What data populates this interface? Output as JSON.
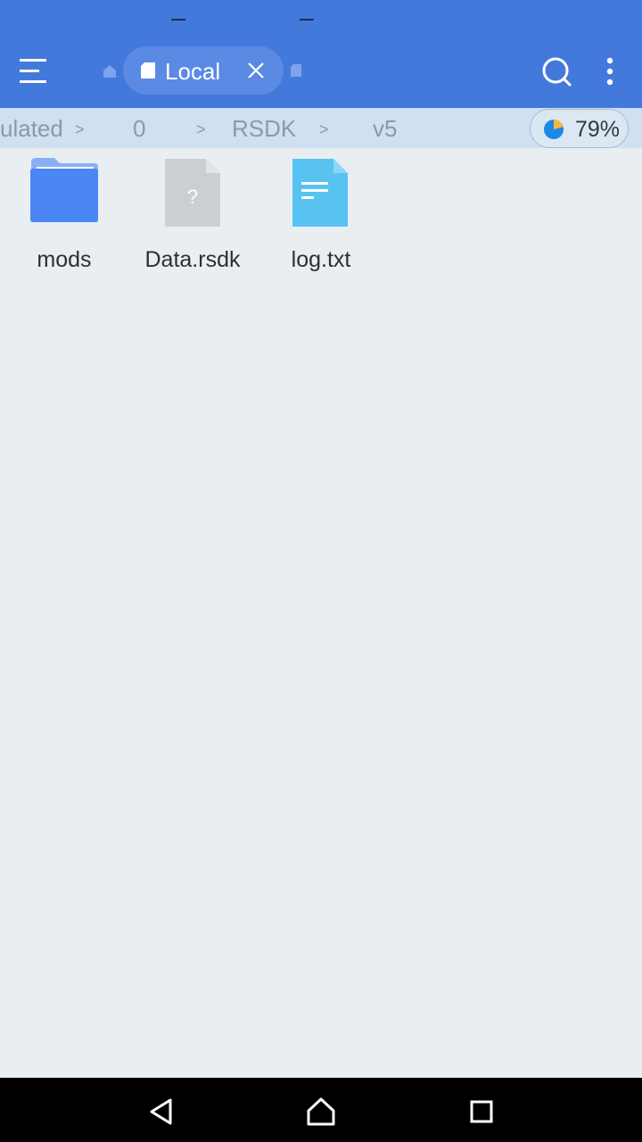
{
  "tabs": {
    "active_label": "Local"
  },
  "breadcrumb": {
    "items": [
      "ulated",
      "0",
      "RSDK",
      "v5"
    ],
    "separator": ">"
  },
  "storage": {
    "percent_text": "79%",
    "used_fraction": 0.79
  },
  "files": [
    {
      "name": "mods",
      "type": "folder-icon"
    },
    {
      "name": "Data.rsdk",
      "type": "unknown-file-icon"
    },
    {
      "name": "log.txt",
      "type": "text-file-icon"
    }
  ],
  "colors": {
    "appbar": "#4479dc",
    "pathbar": "#cfe0f2",
    "background": "#e9eef2",
    "folder": "#4a86f6",
    "text_file": "#58c3f1",
    "unknown_file": "#cbcfd2"
  }
}
